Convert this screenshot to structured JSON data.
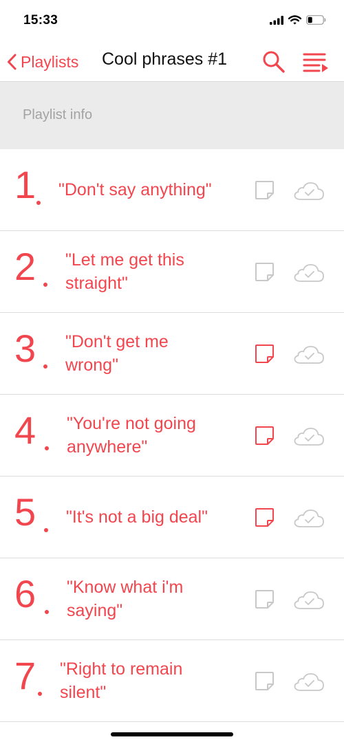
{
  "status_bar": {
    "time": "15:33",
    "icons": [
      "cellular-signal-icon",
      "wifi-icon",
      "battery-icon"
    ]
  },
  "nav": {
    "back_label": "Playlists",
    "title": "Cool phrases #1",
    "icons": [
      "chevron-left-icon",
      "search-icon",
      "queue-list-icon"
    ]
  },
  "info": {
    "label": "Playlist info"
  },
  "items": [
    {
      "number": "1",
      "phrase": "\"Don't say anything\"",
      "note_active": false,
      "downloaded": false
    },
    {
      "number": "2",
      "phrase": "\"Let me get this straight\"",
      "note_active": false,
      "downloaded": false
    },
    {
      "number": "3",
      "phrase": "\"Don't get me wrong\"",
      "note_active": true,
      "downloaded": false
    },
    {
      "number": "4",
      "phrase": "\"You're not going anywhere\"",
      "note_active": true,
      "downloaded": false
    },
    {
      "number": "5",
      "phrase": "\"It's not a big deal\"",
      "note_active": true,
      "downloaded": false
    },
    {
      "number": "6",
      "phrase": "\"Know what i'm saying\"",
      "note_active": false,
      "downloaded": false
    },
    {
      "number": "7",
      "phrase": "\"Right to remain silent\"",
      "note_active": false,
      "downloaded": false
    }
  ],
  "colors": {
    "accent": "#f2464f",
    "icon_inactive": "#c8c8c8",
    "info_background": "#ebebeb",
    "info_text": "#a3a3a3"
  }
}
